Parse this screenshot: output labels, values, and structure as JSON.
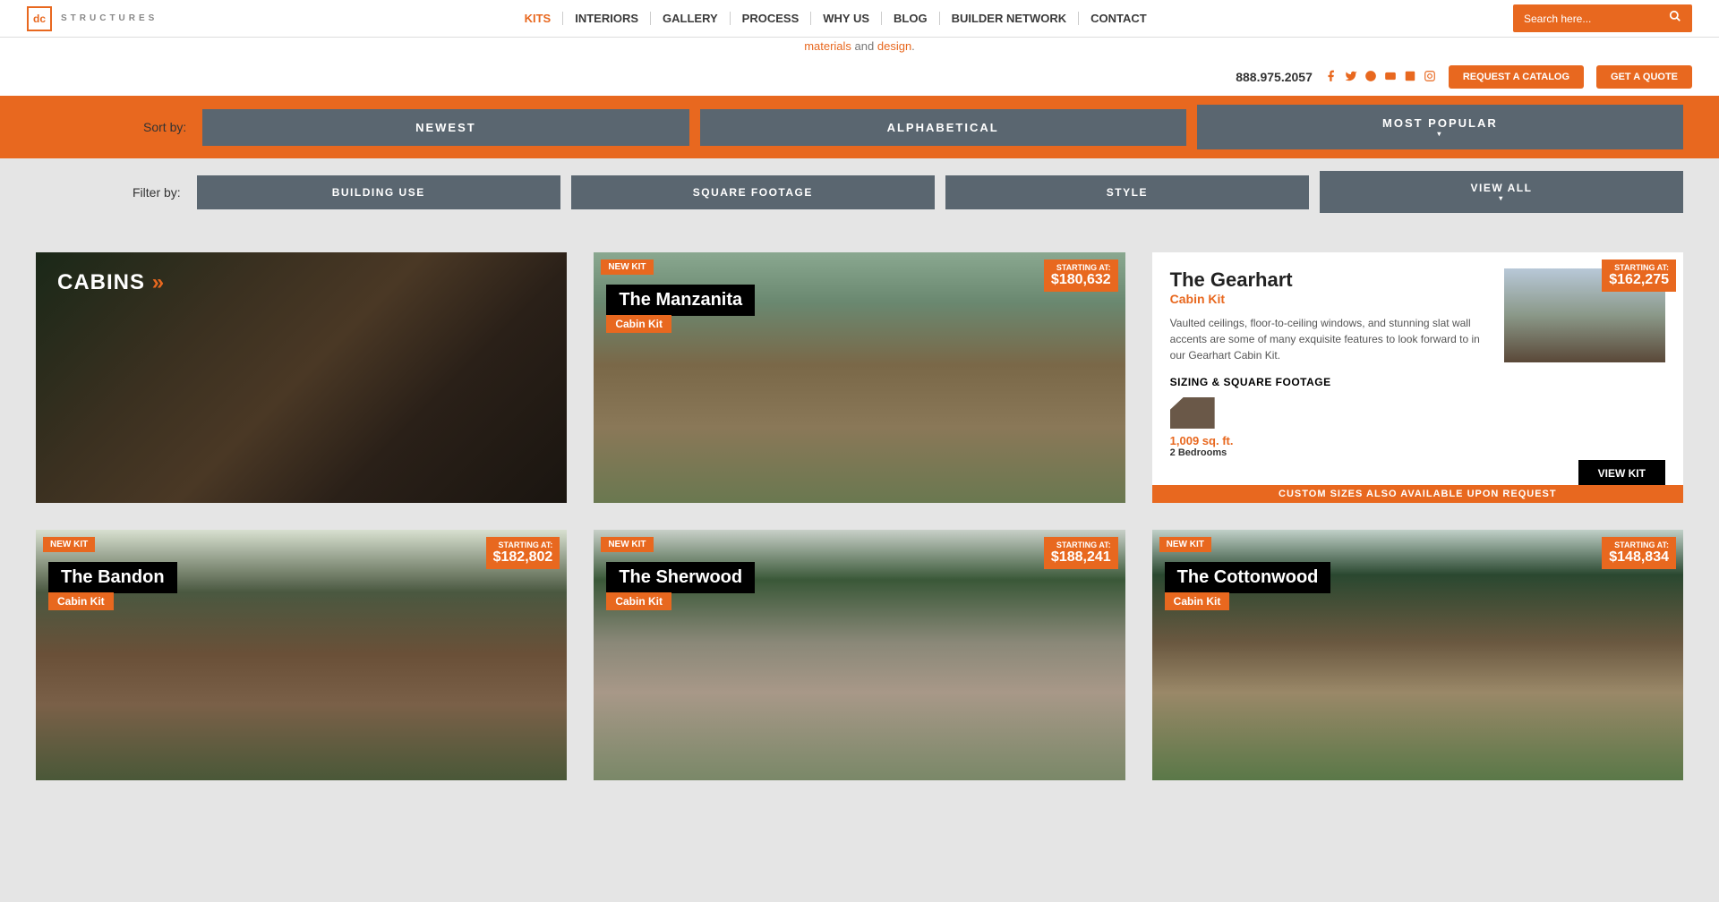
{
  "logo": {
    "abbr": "dc",
    "text": "STRUCTURES"
  },
  "nav": {
    "items": [
      "KITS",
      "INTERIORS",
      "GALLERY",
      "PROCESS",
      "WHY US",
      "BLOG",
      "BUILDER NETWORK",
      "CONTACT"
    ],
    "activeIndex": 0
  },
  "search": {
    "placeholder": "Search here..."
  },
  "phone": "888.975.2057",
  "cta": {
    "catalog": "REQUEST A CATALOG",
    "quote": "GET A QUOTE"
  },
  "tagline": {
    "word1": "materials",
    "and": " and ",
    "word2": "design",
    "dot": "."
  },
  "sort": {
    "label": "Sort by:",
    "options": [
      "NEWEST",
      "ALPHABETICAL",
      "MOST POPULAR"
    ]
  },
  "filter": {
    "label": "Filter by:",
    "options": [
      "BUILDING USE",
      "SQUARE FOOTAGE",
      "STYLE",
      "VIEW ALL"
    ]
  },
  "category": {
    "title": "CABINS"
  },
  "cards": [
    {
      "name": "The Manzanita",
      "sub": "Cabin Kit",
      "new": "NEW KIT",
      "priceLabel": "STARTING AT:",
      "price": "$180,632"
    },
    {
      "name": "The Bandon",
      "sub": "Cabin Kit",
      "new": "NEW KIT",
      "priceLabel": "STARTING AT:",
      "price": "$182,802"
    },
    {
      "name": "The Sherwood",
      "sub": "Cabin Kit",
      "new": "NEW KIT",
      "priceLabel": "STARTING AT:",
      "price": "$188,241"
    },
    {
      "name": "The Cottonwood",
      "sub": "Cabin Kit",
      "new": "NEW KIT",
      "priceLabel": "STARTING AT:",
      "price": "$148,834"
    }
  ],
  "detail": {
    "title": "The Gearhart",
    "sub": "Cabin Kit",
    "priceLabel": "STARTING AT:",
    "price": "$162,275",
    "desc": "Vaulted ceilings, floor-to-ceiling windows, and stunning slat wall accents are some of many exquisite features to look forward to in our Gearhart Cabin Kit.",
    "section": "SIZING & SQUARE FOOTAGE",
    "sqft": "1,009 sq. ft.",
    "beds": "2 Bedrooms",
    "btn": "VIEW KIT",
    "footer": "CUSTOM SIZES ALSO AVAILABLE UPON REQUEST"
  }
}
